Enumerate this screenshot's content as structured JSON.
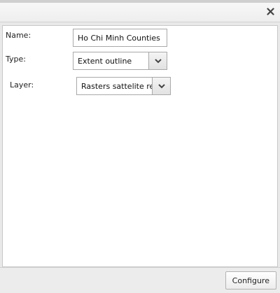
{
  "dialog": {
    "close_icon": "close-icon"
  },
  "form": {
    "name_label": "Name:",
    "name_value": "Ho Chi Minh Counties",
    "type_label": "Type:",
    "type_value": "Extent outline",
    "layer_label": "Layer:",
    "layer_value": "Rasters sattelite ref"
  },
  "footer": {
    "configure_label": "Configure"
  }
}
